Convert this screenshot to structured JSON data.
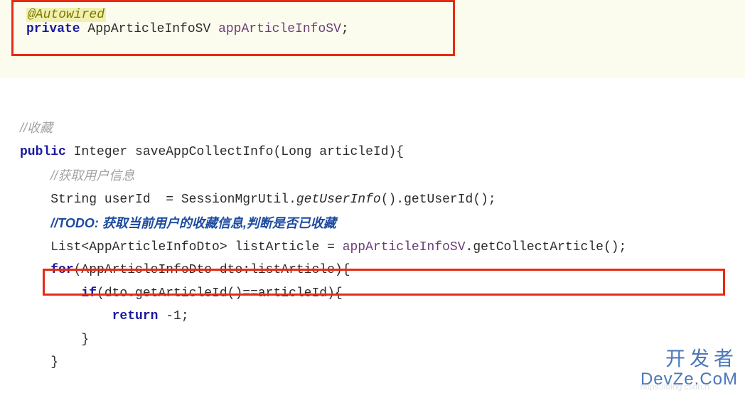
{
  "top": {
    "annotation": "@Autowired",
    "line2_pre": "private ",
    "line2_type": "AppArticleInfoSV ",
    "line2_var": "appArticleInfoSV",
    "line2_post": ";"
  },
  "method": {
    "c1": "//收藏",
    "l2a": "public ",
    "l2b": "Integer saveAppCollectInfo(Long articleId){",
    "c2": "//获取用户信息",
    "l4a": "String userId  = SessionMgrUtil.",
    "l4b": "getUserInfo",
    "l4c": "().getUserId();",
    "todo": "//TODO: 获取当前用户的收藏信息,判断是否已收藏",
    "l6a": "List<AppArticleInfoDto> listArticle = ",
    "l6b": "appArticleInfoSV",
    "l6c": ".getCollectArticle();",
    "l7a": "for",
    "l7b": "(AppArticleInfoDto dto:listArticle){",
    "l8a": "if",
    "l8b": "(dto.getArticleId()==articleId){",
    "l9a": "return ",
    "l9b": "-1",
    "l9c": ";",
    "brace": "}"
  },
  "watermark": {
    "cn": "开发者",
    "en": "DevZe.CoM",
    "csdn": "https://blog.csdn.n"
  }
}
